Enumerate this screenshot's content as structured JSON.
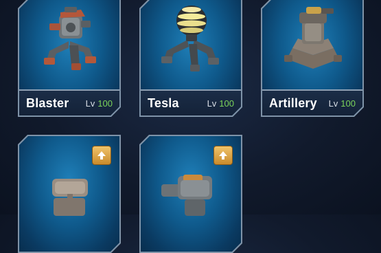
{
  "turrets": [
    {
      "name": "Blaster",
      "lv_label": "Lv",
      "level": "100",
      "upgrade": false
    },
    {
      "name": "Tesla",
      "lv_label": "Lv",
      "level": "100",
      "upgrade": false
    },
    {
      "name": "Artillery",
      "lv_label": "Lv",
      "level": "100",
      "upgrade": false
    },
    {
      "name": "",
      "lv_label": "",
      "level": "",
      "upgrade": true
    },
    {
      "name": "",
      "lv_label": "",
      "level": "",
      "upgrade": true
    }
  ],
  "colors": {
    "card_bg": "#0f5a8c",
    "card_border": "#8ea0b4",
    "footer_bg": "#1b2d47",
    "level_number": "#7bd35a",
    "upgrade_badge": "#e0a84a"
  },
  "icons": {
    "upgrade": "up-arrow-icon"
  }
}
